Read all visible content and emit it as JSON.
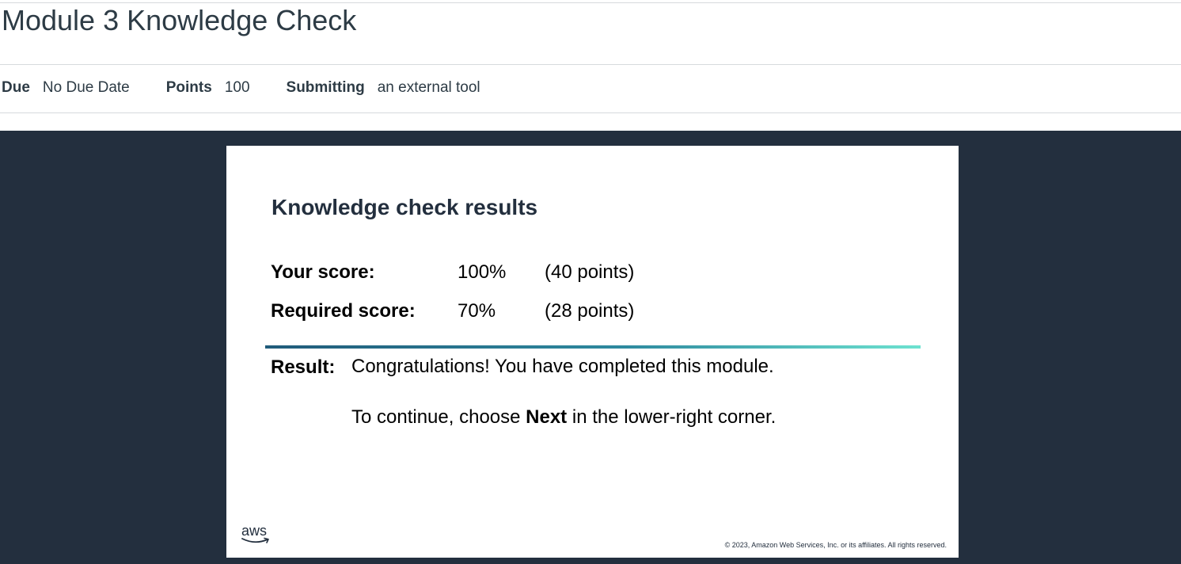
{
  "header": {
    "title": "Module 3 Knowledge Check"
  },
  "meta": {
    "due_label": "Due",
    "due_value": "No Due Date",
    "points_label": "Points",
    "points_value": "100",
    "submitting_label": "Submitting",
    "submitting_value": "an external tool"
  },
  "tool": {
    "title": "Knowledge check results",
    "your_score": {
      "label": "Your score:",
      "percent": "100%",
      "points": "(40 points)"
    },
    "required_score": {
      "label": "Required score:",
      "percent": "70%",
      "points": "(28 points)"
    },
    "result": {
      "label": "Result:",
      "message": "Congratulations! You have completed this module.",
      "continue_before": "To continue, choose ",
      "continue_emphasis": "Next",
      "continue_after": " in the lower-right corner."
    },
    "logo_text": "aws",
    "copyright": "© 2023, Amazon Web Services, Inc. or its affiliates. All rights reserved."
  },
  "colors": {
    "frame_background": "#232f3e",
    "gradient_start": "#205b7a",
    "gradient_end": "#6de2d0",
    "text_dark": "#2d3b45"
  }
}
